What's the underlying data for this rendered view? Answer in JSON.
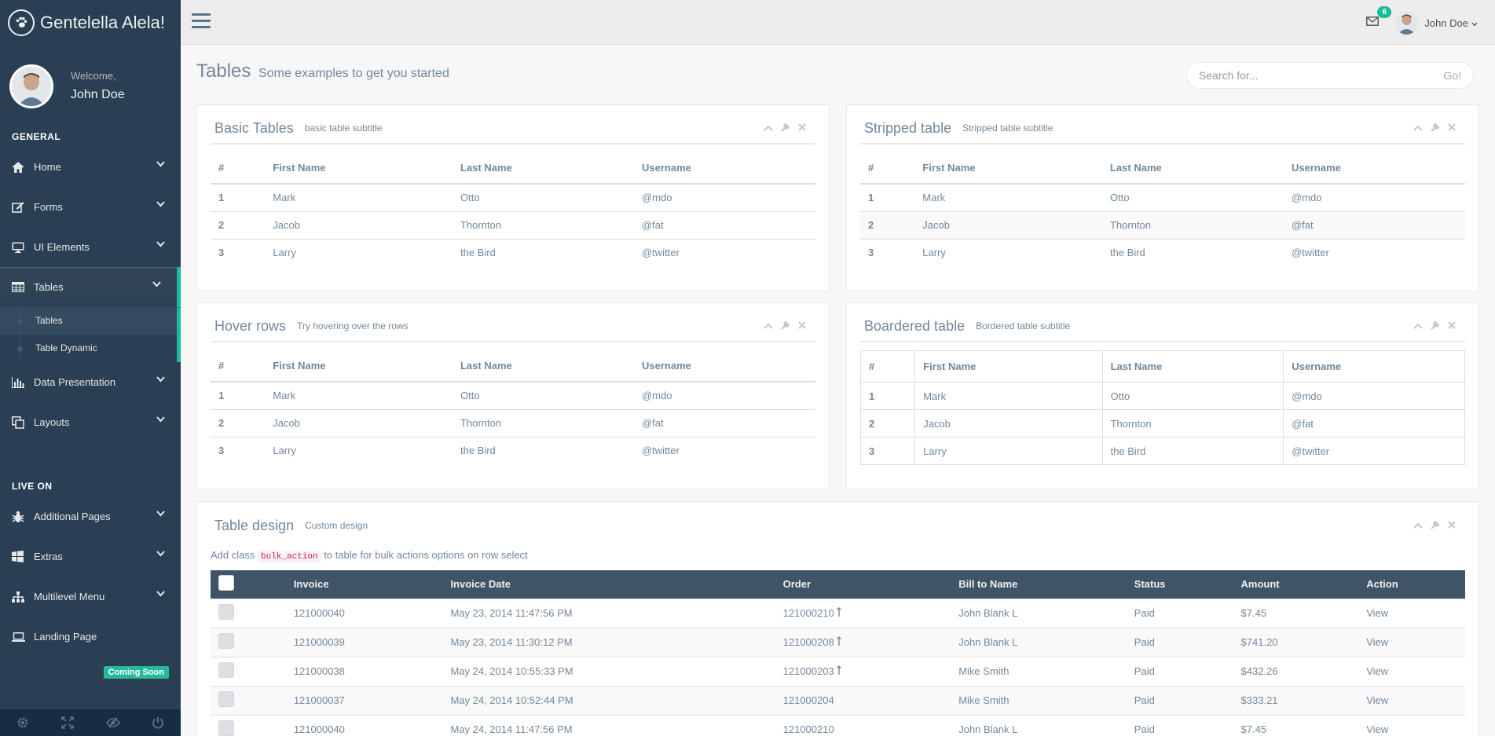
{
  "app": {
    "title": "Gentelella Alela!"
  },
  "profile": {
    "welcome": "Welcome,",
    "name": "John Doe"
  },
  "sidebar": {
    "general_title": "GENERAL",
    "general": [
      {
        "label": "Home",
        "icon": "home-icon"
      },
      {
        "label": "Forms",
        "icon": "edit-icon"
      },
      {
        "label": "UI Elements",
        "icon": "desktop-icon"
      },
      {
        "label": "Tables",
        "icon": "table-icon"
      }
    ],
    "tables_sub": [
      {
        "label": "Tables"
      },
      {
        "label": "Table Dynamic"
      }
    ],
    "general2": [
      {
        "label": "Data Presentation",
        "icon": "bar-chart-icon"
      },
      {
        "label": "Layouts",
        "icon": "clone-icon"
      }
    ],
    "live_title": "LIVE ON",
    "live": [
      {
        "label": "Additional Pages",
        "icon": "bug-icon"
      },
      {
        "label": "Extras",
        "icon": "windows-icon"
      },
      {
        "label": "Multilevel Menu",
        "icon": "sitemap-icon"
      },
      {
        "label": "Landing Page",
        "icon": "laptop-icon"
      }
    ],
    "coming_soon": "Coming Soon"
  },
  "topnav": {
    "mail_count": "6",
    "user_name": "John Doe"
  },
  "page": {
    "title": "Tables",
    "subtitle": "Some examples to get you started",
    "search_placeholder": "Search for...",
    "search_button": "Go!"
  },
  "simple_headers": [
    "#",
    "First Name",
    "Last Name",
    "Username"
  ],
  "simple_rows": [
    [
      "1",
      "Mark",
      "Otto",
      "@mdo"
    ],
    [
      "2",
      "Jacob",
      "Thornton",
      "@fat"
    ],
    [
      "3",
      "Larry",
      "the Bird",
      "@twitter"
    ]
  ],
  "panels": {
    "basic": {
      "title": "Basic Tables",
      "subtitle": "basic table subtitle"
    },
    "striped": {
      "title": "Stripped table",
      "subtitle": "Stripped table subtitle"
    },
    "hover": {
      "title": "Hover rows",
      "subtitle": "Try hovering over the rows"
    },
    "bordered": {
      "title": "Boardered table",
      "subtitle": "Bordered table subtitle"
    },
    "design": {
      "title": "Table design",
      "subtitle": "Custom design",
      "note_pre": "Add class",
      "note_code": "bulk_action",
      "note_post": "to table for bulk actions options on row select"
    }
  },
  "design_table": {
    "headers": [
      "Invoice",
      "Invoice Date",
      "Order",
      "Bill to Name",
      "Status",
      "Amount",
      "Action"
    ],
    "rows": [
      [
        "121000040",
        "May 23, 2014 11:47:56 PM",
        "121000210",
        "John Blank L",
        "Paid",
        "$7.45",
        "View"
      ],
      [
        "121000039",
        "May 23, 2014 11:30:12 PM",
        "121000208",
        "John Blank L",
        "Paid",
        "$741.20",
        "View"
      ],
      [
        "121000038",
        "May 24, 2014 10:55:33 PM",
        "121000203",
        "Mike Smith",
        "Paid",
        "$432.26",
        "View"
      ],
      [
        "121000037",
        "May 24, 2014 10:52:44 PM",
        "121000204",
        "Mike Smith",
        "Paid",
        "$333.21",
        "View"
      ],
      [
        "121000040",
        "May 24, 2014 11:47:56 PM",
        "121000210",
        "John Blank L",
        "Paid",
        "$7.45",
        "View"
      ]
    ],
    "order_arrow_rows": [
      0,
      1,
      2
    ]
  }
}
